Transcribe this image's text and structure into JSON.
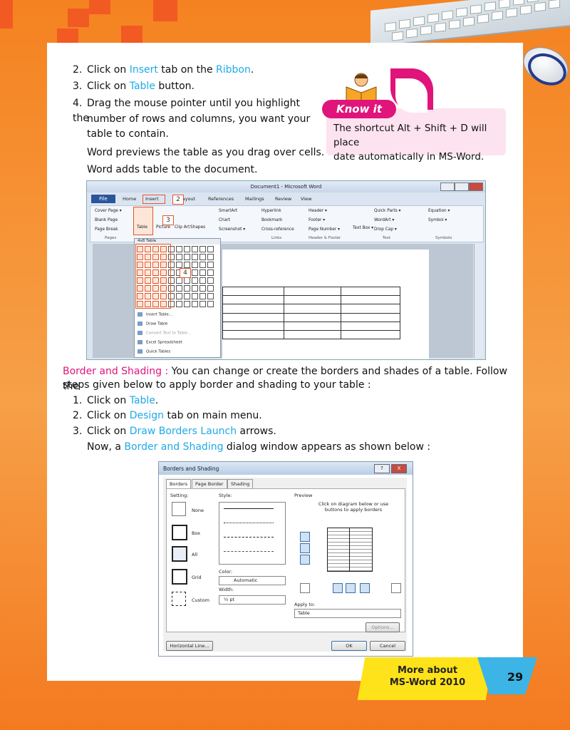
{
  "steps_top": [
    {
      "num": "2.",
      "pre": "Click on ",
      "h1": "Insert",
      "mid": " tab on the ",
      "h2": "Ribbon",
      "post": "."
    },
    {
      "num": "3.",
      "pre": "Click on ",
      "h1": "Table",
      "mid": " button.",
      "h2": "",
      "post": ""
    },
    {
      "num": "4.",
      "text1": "Drag the mouse pointer until you highlight the",
      "text2": "number of rows and columns, you want your",
      "text3": "table to contain."
    }
  ],
  "note1": "Word previews the table as you drag over cells.",
  "note2": "Word adds table to the document.",
  "know_it": {
    "title": "Know it",
    "text1": "The shortcut Alt + Shift + D will place",
    "text2": "date automatically in MS-Word."
  },
  "word": {
    "title": "Document1 - Microsoft Word",
    "file_tab": "File",
    "tabs": [
      "Home",
      "Insert",
      "Layout",
      "References",
      "Mailings",
      "Review",
      "View"
    ],
    "ribbon": {
      "pages": [
        "Cover Page ▾",
        "Blank Page",
        "Page Break"
      ],
      "table_btn": "Table",
      "picture": "Picture",
      "clip_art": "Clip Art",
      "shapes": "Shapes",
      "illus": [
        "SmartArt",
        "Chart",
        "Screenshot ▾"
      ],
      "links": [
        "Hyperlink",
        "Bookmark",
        "Cross-reference"
      ],
      "hf": [
        "Header ▾",
        "Footer ▾",
        "Page Number ▾"
      ],
      "text_box": "Text Box ▾",
      "text_items": [
        "Quick Parts ▾",
        "WordArt ▾",
        "Drop Cap ▾"
      ],
      "symbols": [
        "Equation ▾",
        "Symbol ▾"
      ],
      "groups": [
        "Pages",
        "Links",
        "Header & Footer",
        "Text",
        "Symbols"
      ]
    },
    "dropdown_header": "4x8 Table",
    "dropdown_items": [
      "Insert Table...",
      "Draw Table",
      "Convert Text to Table...",
      "Excel Spreadsheet",
      "Quick Tables"
    ],
    "callouts": [
      "2",
      "3",
      "4"
    ]
  },
  "border_section": {
    "heading": "Border and Shading :",
    "intro1": " You can change or create the borders and shades of a table. Follow the",
    "intro2": "steps given below to apply border and shading to your table :",
    "steps": [
      {
        "num": "1.",
        "pre": "Click on ",
        "hl": "Table",
        "post": "."
      },
      {
        "num": "2.",
        "pre": "Click on ",
        "hl": "Design",
        "post": " tab on main menu."
      },
      {
        "num": "3.",
        "pre": "Click on ",
        "hl": "Draw Borders Launch",
        "post": " arrows."
      }
    ],
    "now_pre": "Now, a ",
    "now_hl": "Border and Shading",
    "now_post": " dialog window appears as shown below :"
  },
  "dialog": {
    "title": "Borders and Shading",
    "help": "?",
    "close": "X",
    "tabs": [
      "Borders",
      "Page Border",
      "Shading"
    ],
    "setting_label": "Setting:",
    "settings": [
      "None",
      "Box",
      "All",
      "Grid",
      "Custom"
    ],
    "style_label": "Style:",
    "color_label": "Color:",
    "color_value": "Automatic",
    "width_label": "Width:",
    "width_value": "½ pt",
    "preview_label": "Preview",
    "preview_hint1": "Click on diagram below or use",
    "preview_hint2": "buttons to apply borders",
    "apply_label": "Apply to:",
    "apply_value": "Table",
    "options_btn": "Options...",
    "hline_btn": "Horizontal Line...",
    "ok_btn": "OK",
    "cancel_btn": "Cancel"
  },
  "footer": {
    "line1": "More about",
    "line2": "MS-Word 2010",
    "page_number": "29"
  },
  "colors": {
    "accent_blue": "#1eaae7",
    "magenta": "#e0147b",
    "orange": "#f47a20"
  }
}
